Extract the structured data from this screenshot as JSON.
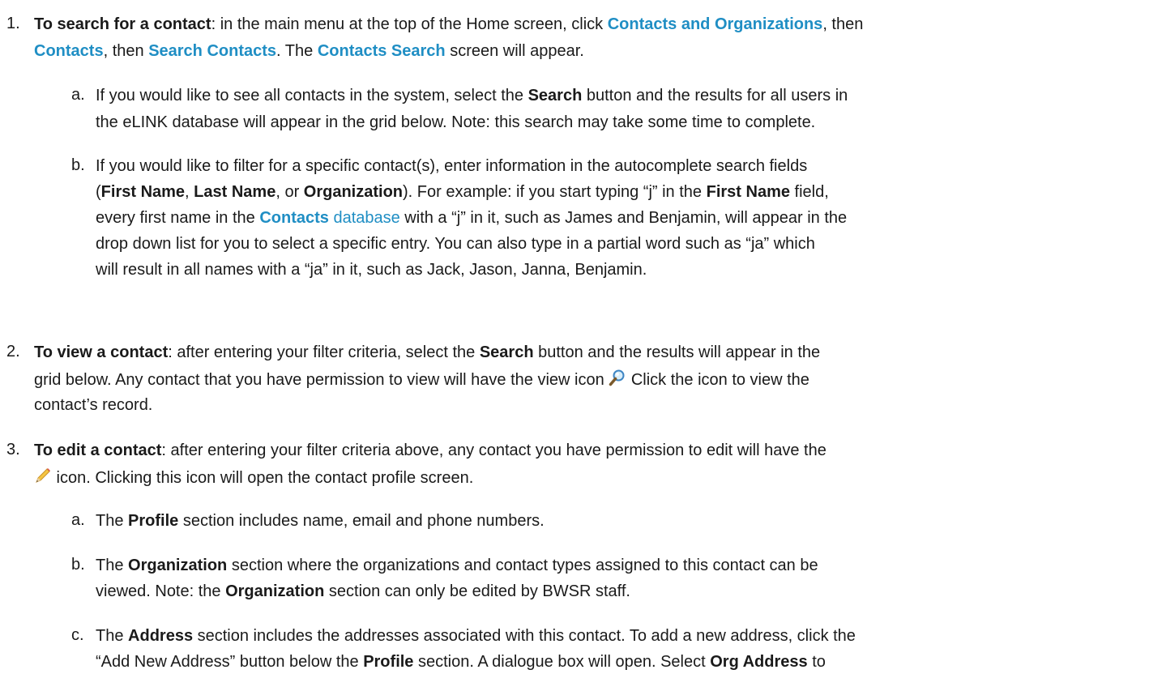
{
  "items": [
    {
      "number": "1.",
      "lines": [
        [
          [
            "b",
            "To search for a contact"
          ],
          [
            "t",
            ": in the main menu at the top of the Home screen, click "
          ],
          [
            "bb",
            "Contacts and Organizations"
          ],
          [
            "t",
            ", then"
          ]
        ],
        [
          [
            "bb",
            "Contacts"
          ],
          [
            "t",
            ", then "
          ],
          [
            "bb",
            "Search Contacts"
          ],
          [
            "t",
            ".  The "
          ],
          [
            "bb",
            "Contacts Search"
          ],
          [
            "t",
            " screen will appear."
          ]
        ]
      ],
      "subs": [
        {
          "letter": "a.",
          "lines": [
            [
              [
                "t",
                "If you would like to see all contacts in the system, select the "
              ],
              [
                "b",
                "Search"
              ],
              [
                "t",
                " button and the results for all users in"
              ]
            ],
            [
              [
                "t",
                "the eLINK database will appear in the grid below.  Note: this search may take some time to complete."
              ]
            ]
          ]
        },
        {
          "letter": "b.",
          "lines": [
            [
              [
                "t",
                "If you would like to filter for a specific contact(s), enter information in the autocomplete search fields"
              ]
            ],
            [
              [
                "t",
                "("
              ],
              [
                "b",
                "First Name"
              ],
              [
                "t",
                ", "
              ],
              [
                "b",
                "Last Name"
              ],
              [
                "t",
                ", or "
              ],
              [
                "b",
                "Organization"
              ],
              [
                "t",
                ").  For example: if you start typing “j” in the "
              ],
              [
                "b",
                "First Name"
              ],
              [
                "t",
                " field,"
              ]
            ],
            [
              [
                "t",
                "every first name in the "
              ],
              [
                "bb",
                "Contacts"
              ],
              [
                "tb",
                " database"
              ],
              [
                "t",
                " with a “j” in it, such as James and Benjamin, will appear in the"
              ]
            ],
            [
              [
                "t",
                "drop down list for you to select a specific entry.  You can also type in a partial word such as “ja” which"
              ]
            ],
            [
              [
                "t",
                "will result in all names with a “ja” in it, such as Jack, Jason, Janna, Benjamin."
              ]
            ]
          ]
        }
      ]
    },
    {
      "number": "2.",
      "lines": [
        [
          [
            "b",
            "To view a contact"
          ],
          [
            "t",
            ": after entering your filter criteria, select the "
          ],
          [
            "b",
            "Search"
          ],
          [
            "t",
            " button and the results will appear in the"
          ]
        ],
        [
          [
            "t",
            "grid below. Any contact that you have permission to view will have the view icon "
          ],
          [
            "icon",
            "magnifier-icon"
          ],
          [
            "t",
            " Click the icon to view the"
          ]
        ],
        [
          [
            "t",
            "contact’s record."
          ]
        ]
      ],
      "subs": []
    },
    {
      "number": "3.",
      "lines": [
        [
          [
            "b",
            "To edit a contact"
          ],
          [
            "t",
            ": after entering your filter criteria above, any contact you have permission to edit will have the"
          ]
        ],
        [
          [
            "icon",
            "pencil-icon"
          ],
          [
            "t",
            " icon.  Clicking this icon will open the contact profile screen."
          ]
        ]
      ],
      "subs": [
        {
          "letter": "a.",
          "lines": [
            [
              [
                "t",
                "The "
              ],
              [
                "b",
                "Profile"
              ],
              [
                "t",
                " section includes name, email and phone numbers."
              ]
            ]
          ]
        },
        {
          "letter": "b.",
          "lines": [
            [
              [
                "t",
                "The "
              ],
              [
                "b",
                "Organization"
              ],
              [
                "t",
                " section where the organizations and contact types assigned to this contact can be"
              ]
            ],
            [
              [
                "t",
                "viewed. Note: the "
              ],
              [
                "b",
                "Organization"
              ],
              [
                "t",
                " section can only be edited by BWSR staff."
              ]
            ]
          ]
        },
        {
          "letter": "c.",
          "lines": [
            [
              [
                "t",
                "The "
              ],
              [
                "b",
                "Address"
              ],
              [
                "t",
                " section includes the addresses associated with this contact.  To add a new address, click the"
              ]
            ],
            [
              [
                "t",
                "“Add New Address” button below the "
              ],
              [
                "b",
                "Profile"
              ],
              [
                "t",
                " section. A dialogue box will open. Select "
              ],
              [
                "b",
                "Org Address"
              ],
              [
                "t",
                " to"
              ]
            ]
          ]
        }
      ]
    }
  ]
}
